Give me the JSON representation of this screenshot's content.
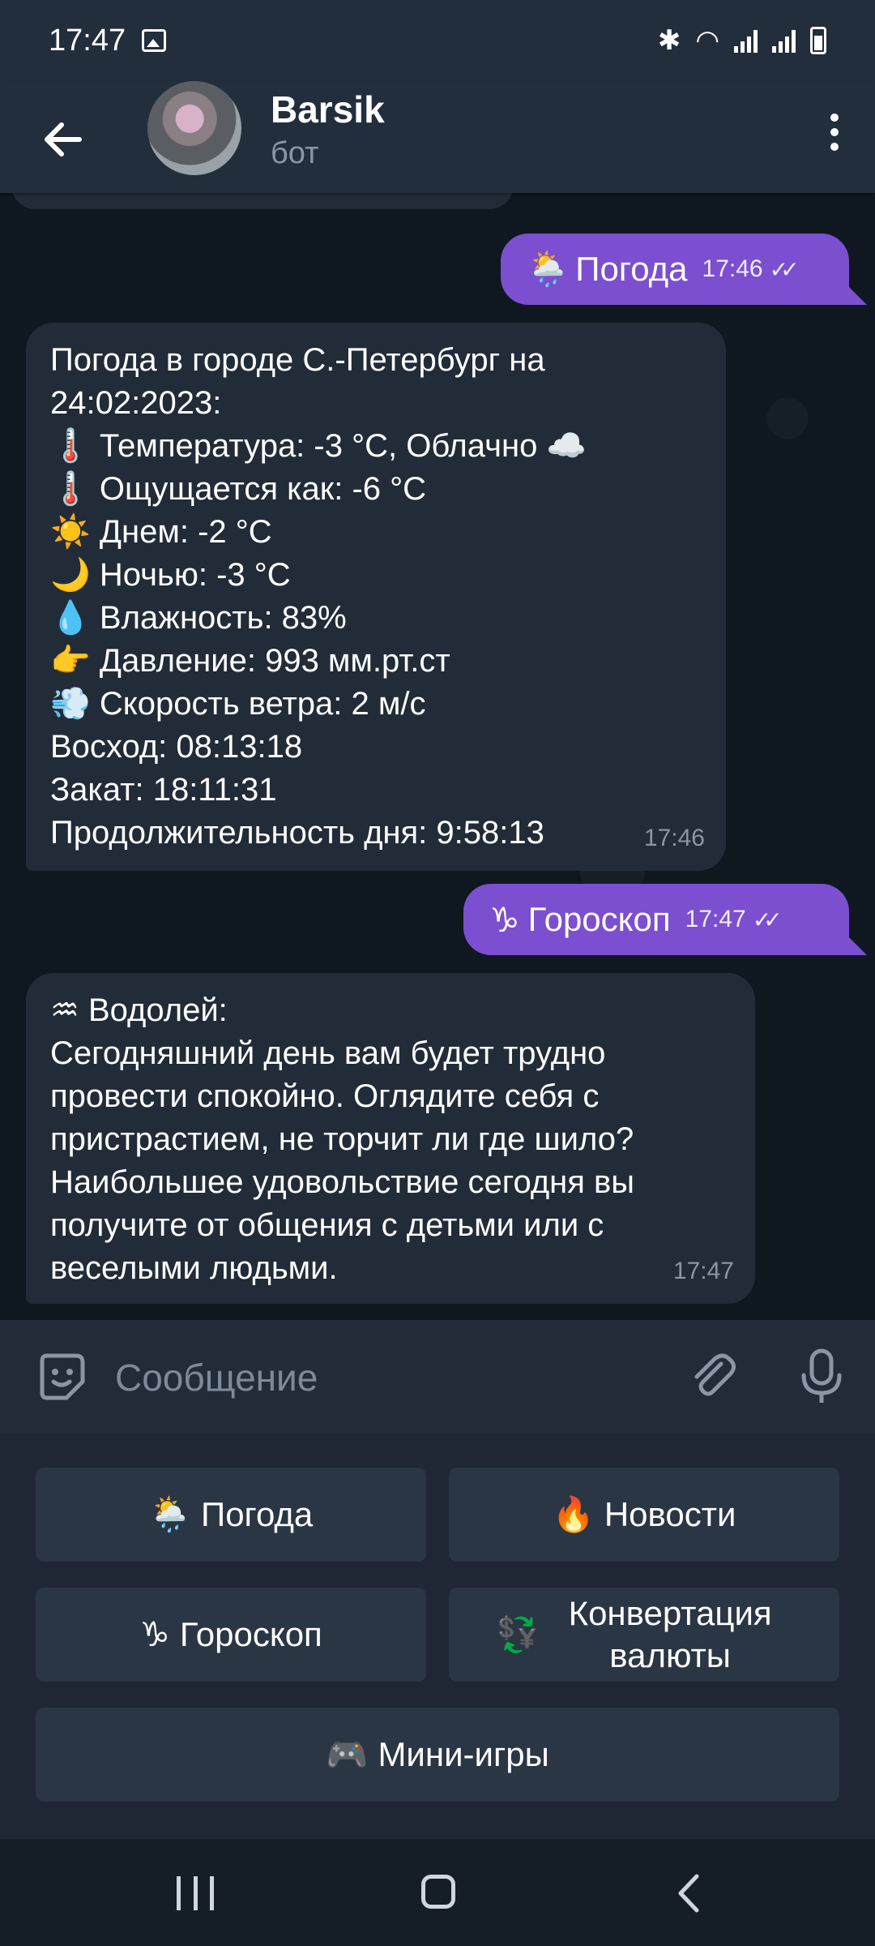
{
  "status_bar": {
    "time": "17:47"
  },
  "header": {
    "title": "Barsik",
    "subtitle": "бот"
  },
  "messages": [
    {
      "type": "out",
      "emoji": "🌦️",
      "text": "Погода",
      "time": "17:46"
    },
    {
      "type": "in",
      "lines": [
        "Погода в городе С.-Петербург на",
        "24:02:2023:",
        "🌡️ Температура: -3 °C, Облачно ☁️",
        "🌡️ Ощущается как: -6 °C",
        "☀️ Днем: -2 °C",
        "🌙 Ночью: -3 °C",
        "💧 Влажность: 83%",
        "👉 Давление: 993 мм.рт.ст",
        "💨 Скорость ветра: 2 м/с",
        "Восход: 08:13:18",
        "Закат: 18:11:31",
        "Продолжительность дня: 9:58:13"
      ],
      "time": "17:46"
    },
    {
      "type": "out",
      "emoji": "♑",
      "text": "Гороскоп",
      "time": "17:47"
    },
    {
      "type": "in",
      "lines": [
        "♒ Водолей:",
        "Сегодняшний день вам будет трудно",
        "провести спокойно. Оглядите себя с",
        "пристрастием, не торчит ли где шило?",
        "Наибольшее удовольствие сегодня вы",
        "получите от общения с детьми или с",
        "веселыми людьми."
      ],
      "time": "17:47"
    }
  ],
  "composer": {
    "placeholder": "Сообщение"
  },
  "keyboard": {
    "buttons": [
      {
        "emoji": "🌦️",
        "label": "Погода"
      },
      {
        "emoji": "🔥",
        "label": "Новости"
      },
      {
        "emoji": "♑",
        "label": "Гороскоп"
      },
      {
        "emoji": "💱",
        "label": "Конвертация валюты"
      },
      {
        "emoji": "🎮",
        "label": "Мини-игры"
      }
    ]
  },
  "icons": {
    "back": "arrow-left-icon",
    "menu": "more-vertical-icon",
    "sticker": "sticker-icon",
    "attach": "paperclip-icon",
    "mic": "microphone-icon"
  },
  "colors": {
    "outgoing_bubble": "#7b4fcf",
    "incoming_bubble": "#222c38",
    "header_bg": "#232e3c",
    "chat_bg": "#0f1721",
    "keyboard_button": "#2a3644"
  }
}
